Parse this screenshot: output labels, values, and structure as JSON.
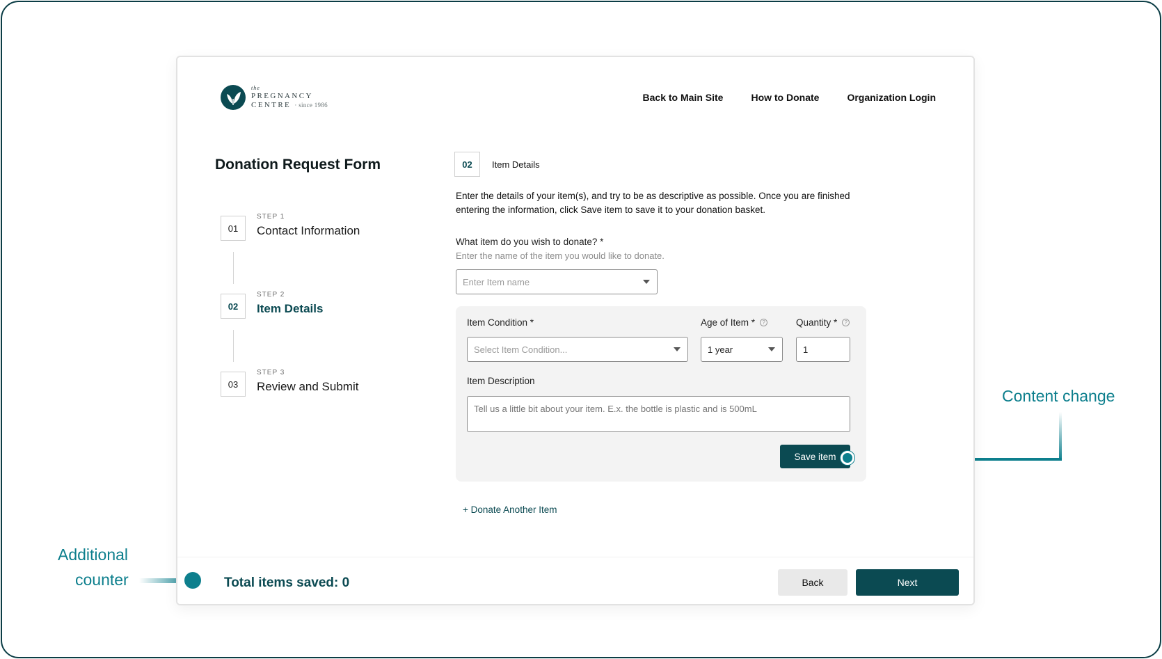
{
  "logo": {
    "the": "the",
    "line1": "PREGNANCY",
    "line2": "CENTRE",
    "since": "· since 1986"
  },
  "nav": {
    "items": [
      "Back to Main Site",
      "How to Donate",
      "Organization Login"
    ]
  },
  "form_title": "Donation Request Form",
  "steps": [
    {
      "number": "01",
      "kicker": "STEP 1",
      "name": "Contact Information",
      "active": false
    },
    {
      "number": "02",
      "kicker": "STEP 2",
      "name": "Item Details",
      "active": true
    },
    {
      "number": "03",
      "kicker": "STEP 3",
      "name": "Review and Submit",
      "active": false
    }
  ],
  "section": {
    "number": "02",
    "name": "Item Details",
    "intro": "Enter the details of your item(s), and try to be as descriptive as possible. Once you are finished entering the information, click Save item to save it to your donation basket."
  },
  "item_question": {
    "label": "What item do you wish to donate? *",
    "help": "Enter the name of the item you would like to donate.",
    "placeholder": "Enter Item name"
  },
  "panel": {
    "condition_label": "Item Condition *",
    "condition_placeholder": "Select Item Condition...",
    "age_label": "Age of Item *",
    "age_value": "1 year",
    "quantity_label": "Quantity *",
    "quantity_value": "1",
    "help_glyph": "?",
    "description_label": "Item Description",
    "description_placeholder": "Tell us a little bit about your item. E.x. the bottle is plastic and is 500mL",
    "save_label": "Save item"
  },
  "donate_another": "+ Donate Another Item",
  "footer": {
    "total_label": "Total items saved: 0",
    "back_label": "Back",
    "next_label": "Next"
  },
  "annotations": {
    "content_change": "Content change",
    "additional_line1": "Additional",
    "additional_line2": "counter"
  },
  "colors": {
    "brand": "#0b4a52",
    "annotation": "#0d7f8d",
    "panel_bg": "#f3f3f3"
  }
}
